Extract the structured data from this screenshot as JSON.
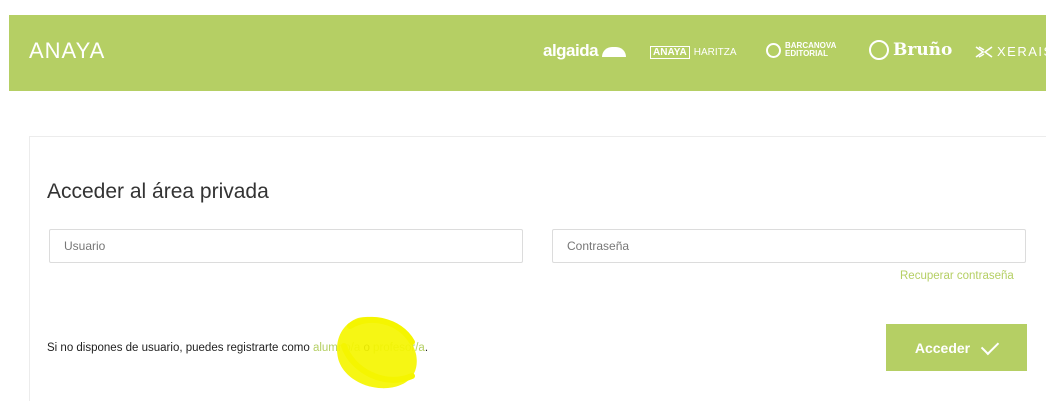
{
  "header": {
    "logo": "ANAYA",
    "brands": {
      "algaida": "algaida",
      "anaya_haritza_a": "ANAYA",
      "anaya_haritza_b": "HARITZA",
      "barcanova_a": "BARCANOVA",
      "barcanova_b": "EDITORIAL",
      "bruno": "Bruño",
      "xerais": "XERAIS"
    }
  },
  "login": {
    "title": "Acceder al área privada",
    "user_placeholder": "Usuario",
    "password_placeholder": "Contraseña",
    "recover_link": "Recuperar contraseña",
    "register_prefix": "Si no dispones de usuario, puedes registrarte como ",
    "register_student": "alumno/a",
    "register_or": " o ",
    "register_teacher": "profesor/a",
    "register_suffix": ".",
    "submit_label": "Acceder"
  },
  "colors": {
    "brand_green": "#b5cf64",
    "highlight_yellow": "#f5f500"
  },
  "icons": {
    "submit": "checkmark-icon"
  }
}
